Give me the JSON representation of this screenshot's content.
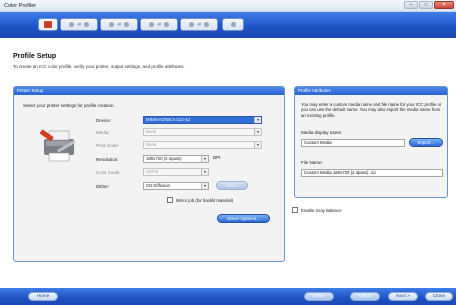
{
  "window": {
    "title": "Color Profiler"
  },
  "steps": [
    "home",
    "step-1",
    "step-2",
    "step-3",
    "step-4",
    "finish"
  ],
  "header": {
    "title": "Profile Setup",
    "description": "To create an ICC color profile, verify your printer, output settings, and profile attributes."
  },
  "printer_setup": {
    "panel_title": "Printer Setup",
    "subtitle": "Select your printer settings for profile creation.",
    "device_label": "Device:",
    "device_value": "MINW KONICA 512-42",
    "media_label": "Media:",
    "media_value": "None",
    "print_mode_label": "Print mode:",
    "print_mode_value": "None",
    "resolution_label": "Resolution:",
    "resolution_value": "180x720 (2.4pass)",
    "resolution_unit": "DPI",
    "color_mode_label": "Color mode:",
    "color_mode_value": "CMYK",
    "dither_label": "Dither:",
    "dither_value": "SO Diffusion",
    "edit_button": "Edit...",
    "mirror_label": "Mirror job (for backlit material)",
    "driver_options_button": "Driver Options..."
  },
  "profile_attributes": {
    "panel_title": "Profile Attributes",
    "help_text": "You may enter a custom media name and file name for your ICC profile or you can use the default name. You may also import the media name from an existing profile.",
    "media_display_label": "Media display name:",
    "media_display_value": "Custom Media",
    "import_button": "Import...",
    "file_name_label": "File Name:",
    "file_name_value": "Custom Media 180x720 (2.4pass) .icc"
  },
  "gray_balance_label": "Enable Gray Balance",
  "footer": {
    "home": "Home",
    "save": "Save",
    "back": "< Back",
    "next": "Next >",
    "close": "Close"
  },
  "colors": {
    "accent_blue": "#2a63cf",
    "selection_blue": "#2f6fd6"
  }
}
